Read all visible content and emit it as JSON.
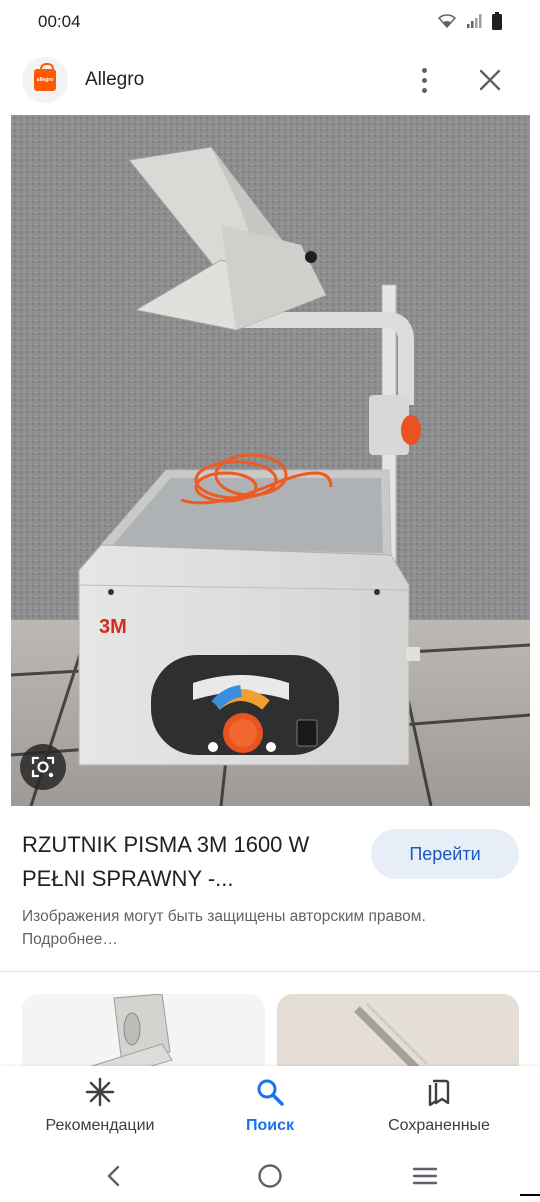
{
  "status_bar": {
    "time": "00:04"
  },
  "header": {
    "site_name": "Allegro",
    "logo_text": "allegro"
  },
  "result": {
    "title": "RZUTNIK PISMA 3M 1600 W PEŁNI SPRAWNY -...",
    "visit_button": "Перейти",
    "copyright_notice": "Изображения могут быть защищены авторским правом. Подробнее…",
    "image_logo_text": "3M"
  },
  "bottom_nav": {
    "items": [
      {
        "label": "Рекомендации",
        "icon": "asterisk-icon"
      },
      {
        "label": "Поиск",
        "icon": "search-icon"
      },
      {
        "label": "Сохраненные",
        "icon": "bookmarks-icon"
      }
    ]
  },
  "colors": {
    "accent": "#1a73e8",
    "button_bg": "#e8eef8",
    "brand": "#ff5a00"
  }
}
